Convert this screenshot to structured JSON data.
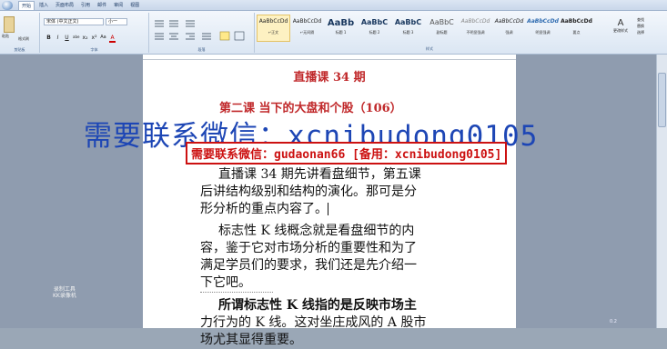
{
  "ribbon": {
    "tabs": [
      "开始",
      "插入",
      "页面布局",
      "引用",
      "邮件",
      "审阅",
      "视图"
    ],
    "paste_label": "粘贴",
    "font_name": "宋体 (中文正文)",
    "font_size": "小一",
    "format_painter": "格式刷",
    "format_buttons": [
      "B",
      "I",
      "U",
      "abe",
      "x₂",
      "x²",
      "Aa",
      "A"
    ],
    "groups": [
      "剪贴板",
      "字体",
      "段落",
      "样式"
    ],
    "styles": [
      {
        "sample": "AaBbCcDd",
        "name": "↵正文"
      },
      {
        "sample": "AaBbCcDd",
        "name": "↵无间隔"
      },
      {
        "sample": "AaBb",
        "name": "标题 1"
      },
      {
        "sample": "AaBbC",
        "name": "标题 2"
      },
      {
        "sample": "AaBbC",
        "name": "标题 3"
      },
      {
        "sample": "AaBbC",
        "name": "副标题"
      },
      {
        "sample": "AaBbCcDd",
        "name": "不明显强调"
      },
      {
        "sample": "AaBbCcDd",
        "name": "强调"
      },
      {
        "sample": "AaBbCcDd",
        "name": "明显强调"
      },
      {
        "sample": "AaBbCcDd",
        "name": "要点"
      },
      {
        "sample": "AaBbCcDd",
        "name": "引用"
      }
    ],
    "change_styles": "更改样式",
    "edit_items": [
      "查找",
      "替换",
      "选择"
    ]
  },
  "document": {
    "title": "直播课 34 期",
    "lesson_heading": "第二课  当下的大盘和个股（106）",
    "lines": [
      "直播课 34 期先讲看盘细节，第五课",
      "后讲结构级别和结构的演化。那可是分",
      "形分析的重点内容了。",
      "标志性 K 线概念就是看盘细节的内",
      "容，鉴于它对市场分析的重要性和为了",
      "满足学员们的要求，我们还是先介绍一",
      "下它吧。",
      "所谓标志性 K 线指的是反映市场主",
      "力行为的 K 线。这对坐庄成风的 A 股市",
      "场尤其显得重要。"
    ]
  },
  "overlays": {
    "watermark_blue": "需要联系微信：xcnibudong0105",
    "watermark_red": "需要联系微信：gudaonan66 [备用：xcnibudong0105]",
    "recorder_line1": "录制工具",
    "recorder_line2": "KK录像机"
  },
  "statusbar": {
    "zoom": "0.2"
  }
}
